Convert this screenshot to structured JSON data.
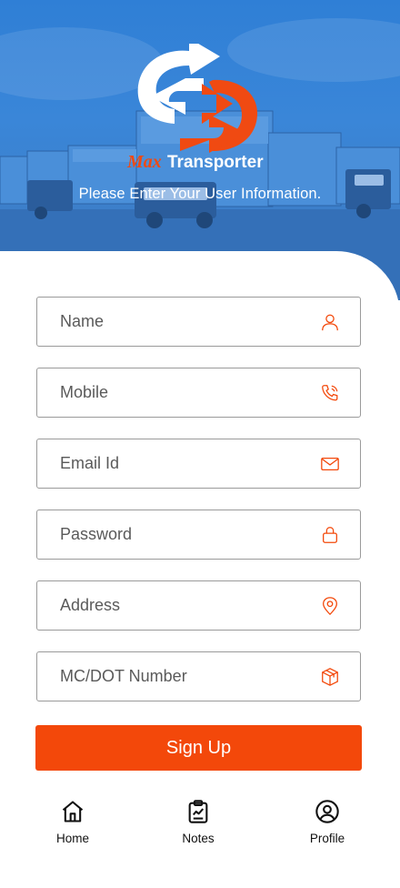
{
  "header": {
    "brand_prefix": "Max",
    "brand_suffix": "Transporter",
    "tagline": "Please Enter Your User Information."
  },
  "form": {
    "fields": [
      {
        "placeholder": "Name",
        "icon": "user-icon"
      },
      {
        "placeholder": "Mobile",
        "icon": "phone-icon"
      },
      {
        "placeholder": "Email Id",
        "icon": "mail-icon"
      },
      {
        "placeholder": "Password",
        "icon": "lock-icon"
      },
      {
        "placeholder": "Address",
        "icon": "location-pin-icon"
      },
      {
        "placeholder": "MC/DOT Number",
        "icon": "box-icon"
      }
    ],
    "submit_label": "Sign Up"
  },
  "nav": {
    "items": [
      {
        "label": "Home",
        "icon": "home-icon"
      },
      {
        "label": "Notes",
        "icon": "clipboard-icon"
      },
      {
        "label": "Profile",
        "icon": "profile-icon"
      }
    ]
  },
  "colors": {
    "accent": "#f3480a",
    "hero_blue": "#3a86d8",
    "logo_orange": "#f04a12"
  }
}
